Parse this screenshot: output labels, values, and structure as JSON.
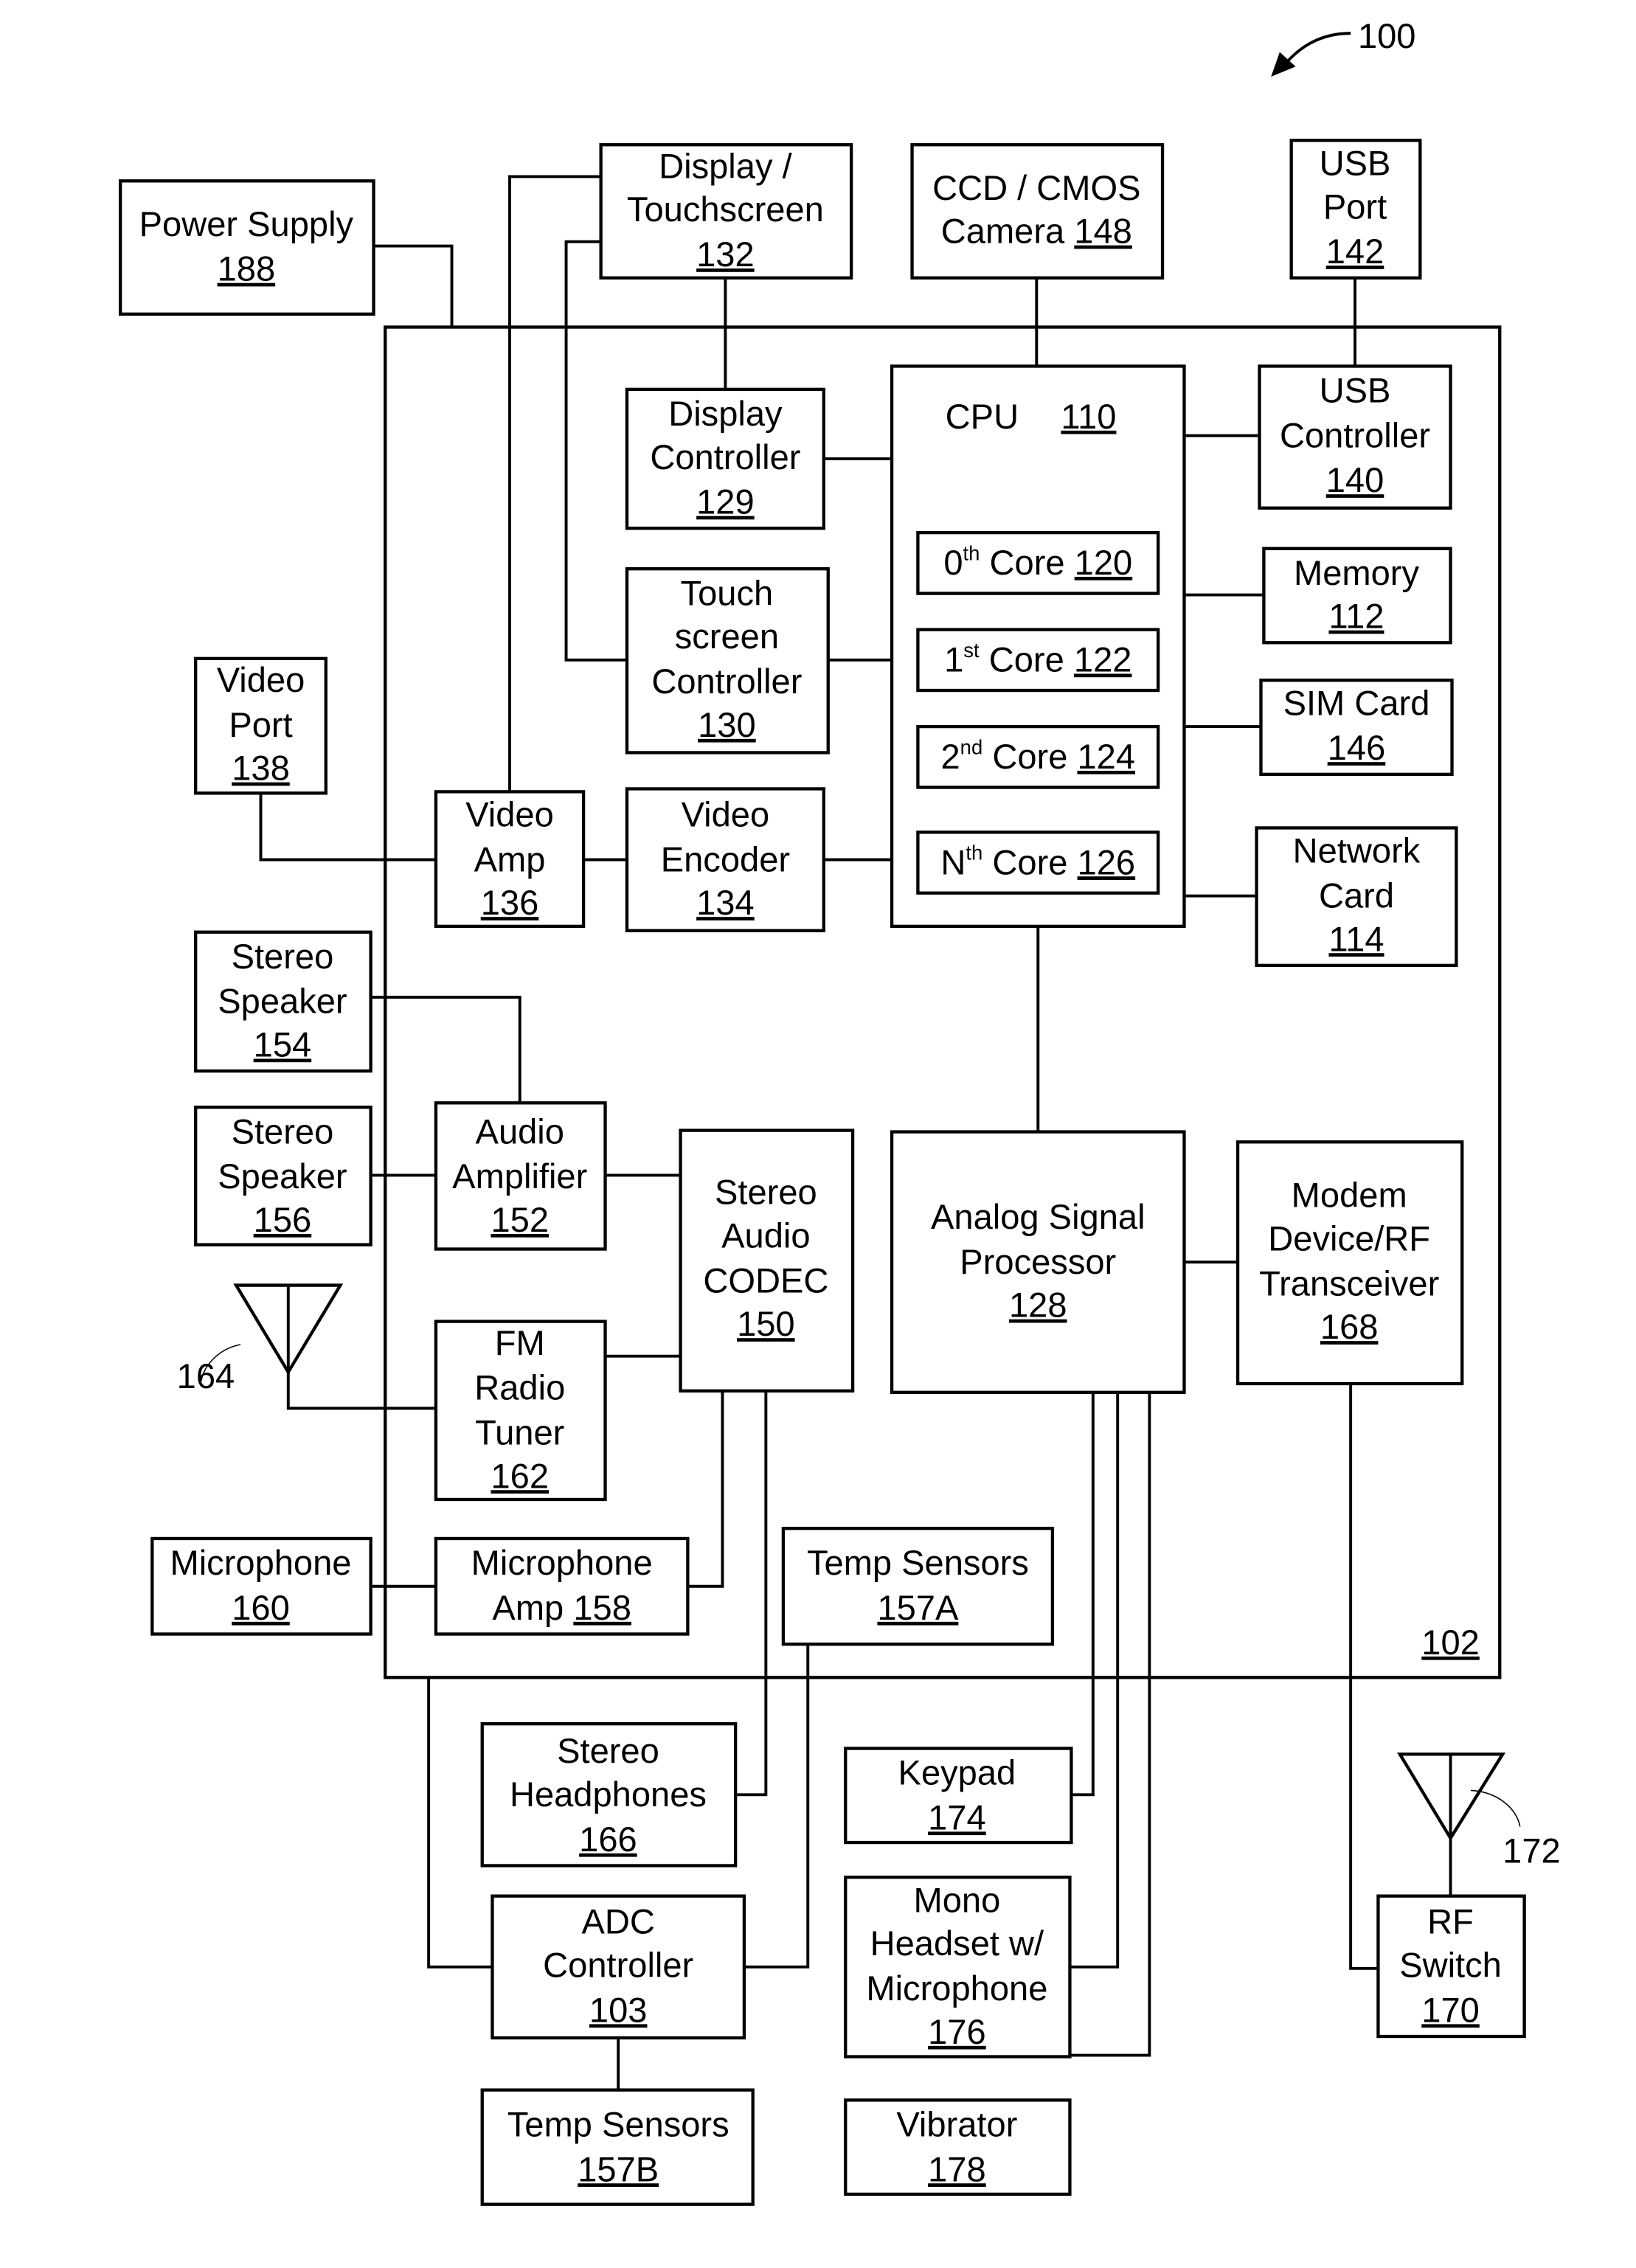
{
  "figure": {
    "ref_number": "100",
    "board_ref": "102"
  },
  "blocks": {
    "power_supply": {
      "lines": [
        "Power Supply"
      ],
      "ref": "188"
    },
    "display_touchscreen": {
      "lines": [
        "Display /",
        "Touchscreen"
      ],
      "ref": "132"
    },
    "camera": {
      "lines": [
        "CCD / CMOS",
        "Camera"
      ],
      "ref": "148"
    },
    "usb_port": {
      "lines": [
        "USB",
        "Port"
      ],
      "ref": "142"
    },
    "display_controller": {
      "lines": [
        "Display",
        "Controller"
      ],
      "ref": "129"
    },
    "cpu": {
      "lines": [
        "CPU"
      ],
      "ref": "110"
    },
    "usb_controller": {
      "lines": [
        "USB",
        "Controller"
      ],
      "ref": "140"
    },
    "core0": {
      "ordinal": "0",
      "sup": "th",
      "label": "Core",
      "ref": "120"
    },
    "core1": {
      "ordinal": "1",
      "sup": "st",
      "label": "Core",
      "ref": "122"
    },
    "core2": {
      "ordinal": "2",
      "sup": "nd",
      "label": "Core",
      "ref": "124"
    },
    "coreN": {
      "ordinal": "N",
      "sup": "th",
      "label": "Core",
      "ref": "126"
    },
    "memory": {
      "lines": [
        "Memory"
      ],
      "ref": "112"
    },
    "sim_card": {
      "lines": [
        "SIM Card"
      ],
      "ref": "146"
    },
    "network_card": {
      "lines": [
        "Network",
        "Card"
      ],
      "ref": "114"
    },
    "touchscreen_controller": {
      "lines": [
        "Touch",
        "screen",
        "Controller"
      ],
      "ref": "130"
    },
    "video_port": {
      "lines": [
        "Video",
        "Port"
      ],
      "ref": "138"
    },
    "video_amp": {
      "lines": [
        "Video",
        "Amp"
      ],
      "ref": "136"
    },
    "video_encoder": {
      "lines": [
        "Video",
        "Encoder"
      ],
      "ref": "134"
    },
    "stereo_speaker_1": {
      "lines": [
        "Stereo",
        "Speaker"
      ],
      "ref": "154"
    },
    "stereo_speaker_2": {
      "lines": [
        "Stereo",
        "Speaker"
      ],
      "ref": "156"
    },
    "audio_amplifier": {
      "lines": [
        "Audio",
        "Amplifier"
      ],
      "ref": "152"
    },
    "stereo_audio_codec": {
      "lines": [
        "Stereo",
        "Audio",
        "CODEC"
      ],
      "ref": "150"
    },
    "analog_signal_processor": {
      "lines": [
        "Analog Signal",
        "Processor"
      ],
      "ref": "128"
    },
    "modem": {
      "lines": [
        "Modem",
        "Device/RF",
        "Transceiver"
      ],
      "ref": "168"
    },
    "fm_radio_tuner": {
      "lines": [
        "FM",
        "Radio",
        "Tuner"
      ],
      "ref": "162"
    },
    "microphone": {
      "lines": [
        "Microphone"
      ],
      "ref": "160"
    },
    "microphone_amp": {
      "lines": [
        "Microphone"
      ],
      "inline": "Amp",
      "ref": "158"
    },
    "temp_sensors_a": {
      "lines": [
        "Temp Sensors"
      ],
      "ref": "157A"
    },
    "stereo_headphones": {
      "lines": [
        "Stereo",
        "Headphones"
      ],
      "ref": "166"
    },
    "keypad": {
      "lines": [
        "Keypad"
      ],
      "ref": "174"
    },
    "adc_controller": {
      "lines": [
        "ADC",
        "Controller"
      ],
      "ref": "103"
    },
    "mono_headset": {
      "lines": [
        "Mono",
        "Headset w/",
        "Microphone"
      ],
      "ref": "176"
    },
    "temp_sensors_b": {
      "lines": [
        "Temp Sensors"
      ],
      "ref": "157B"
    },
    "vibrator": {
      "lines": [
        "Vibrator"
      ],
      "ref": "178"
    },
    "rf_switch": {
      "lines": [
        "RF",
        "Switch"
      ],
      "ref": "170"
    }
  },
  "antennas": {
    "fm_antenna_ref": "164",
    "rf_antenna_ref": "172"
  }
}
